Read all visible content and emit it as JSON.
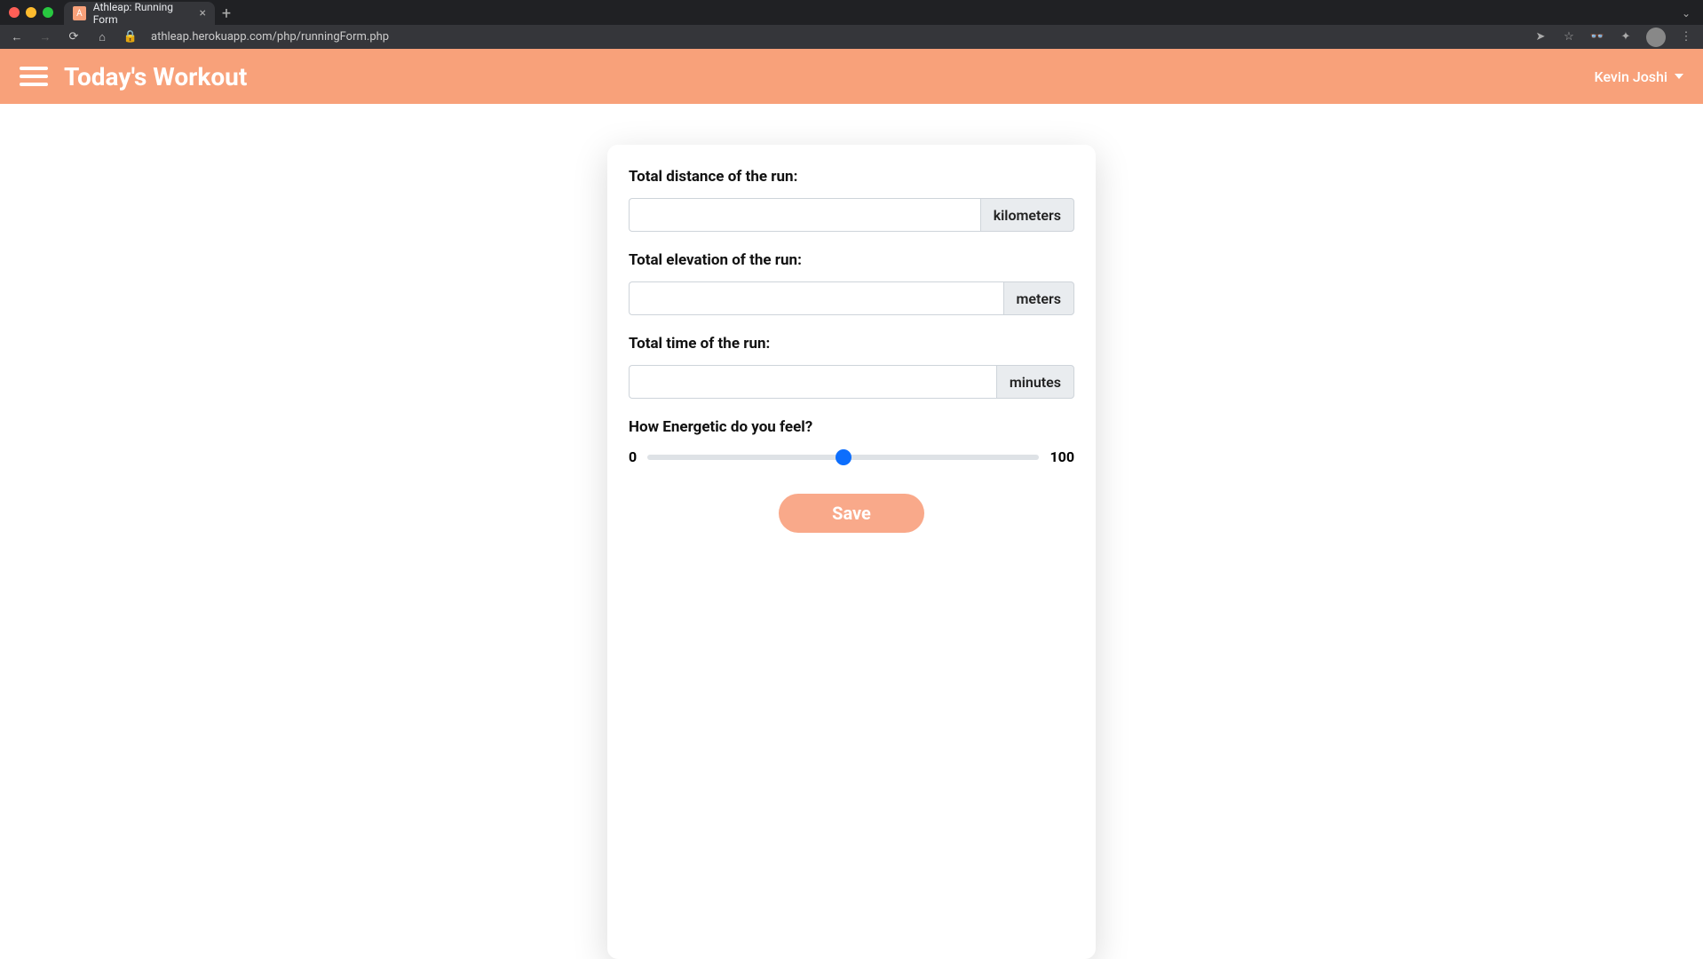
{
  "browser": {
    "tab_title": "Athleap: Running Form",
    "favicon_letter": "A",
    "url": "athleap.herokuapp.com/php/runningForm.php"
  },
  "header": {
    "title": "Today's Workout",
    "user_name": "Kevin Joshi"
  },
  "form": {
    "distance": {
      "label": "Total distance of the run:",
      "value": "",
      "unit": "kilometers"
    },
    "elevation": {
      "label": "Total elevation of the run:",
      "value": "",
      "unit": "meters"
    },
    "time": {
      "label": "Total time of the run:",
      "value": "",
      "unit": "minutes"
    },
    "energy": {
      "label": "How Energetic do you feel?",
      "min": "0",
      "max": "100",
      "value": 50
    },
    "save_label": "Save"
  }
}
